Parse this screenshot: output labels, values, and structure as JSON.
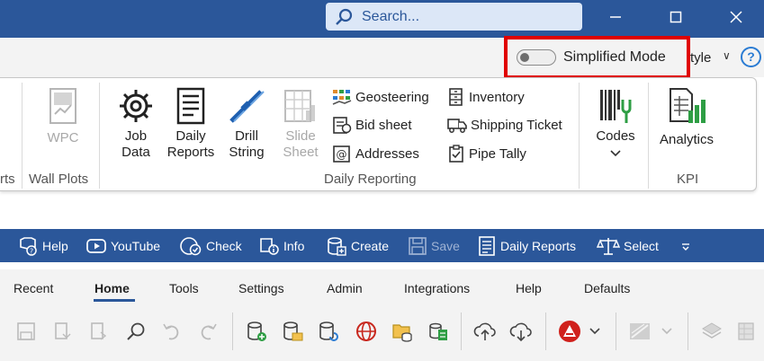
{
  "titlebar": {
    "search_placeholder": "Search..."
  },
  "options": {
    "simplified_mode_label": "Simplified Mode",
    "style_label": "tyle",
    "help_symbol": "?"
  },
  "ribbon": {
    "wpc": {
      "label": "WPC"
    },
    "groups": {
      "partial": "rts",
      "wall_plots": "Wall Plots",
      "daily_reporting": "Daily Reporting",
      "kpi": "KPI"
    },
    "big": {
      "job_data": [
        "Job",
        "Data"
      ],
      "daily_reports": [
        "Daily",
        "Reports"
      ],
      "drill_string": [
        "Drill",
        "String"
      ],
      "slide_sheet": [
        "Slide",
        "Sheet"
      ],
      "codes": "Codes",
      "analytics": "Analytics"
    },
    "small": {
      "geosteering": "Geosteering",
      "bid_sheet": "Bid sheet",
      "addresses": "Addresses",
      "inventory": "Inventory",
      "shipping_ticket": "Shipping Ticket",
      "pipe_tally": "Pipe Tally"
    }
  },
  "qat": {
    "help": "Help",
    "youtube": "YouTube",
    "check": "Check",
    "info": "Info",
    "create": "Create",
    "save": "Save",
    "daily_reports": "Daily Reports",
    "select": "Select"
  },
  "tabs": [
    "Recent",
    "Home",
    "Tools",
    "Settings",
    "Admin",
    "Integrations",
    "Help",
    "Defaults"
  ],
  "colors": {
    "brand_blue": "#2b579a",
    "highlight_red": "#e00000",
    "analytics_green": "#2e9e44"
  }
}
